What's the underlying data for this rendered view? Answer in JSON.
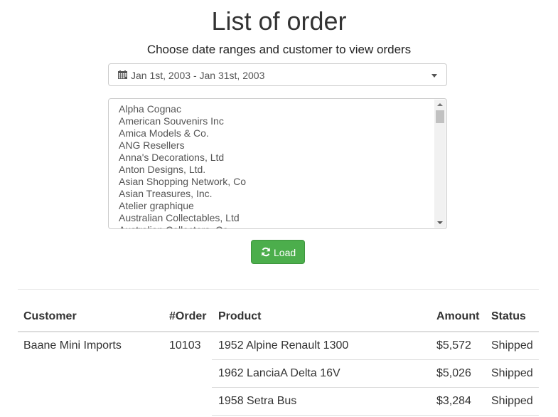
{
  "page_title": "List of order",
  "subtitle": "Choose date ranges and customer to view orders",
  "date_range": "Jan 1st, 2003 - Jan 31st, 2003",
  "customers": [
    "Alpha Cognac",
    "American Souvenirs Inc",
    "Amica Models & Co.",
    "ANG Resellers",
    "Anna's Decorations, Ltd",
    "Anton Designs, Ltd.",
    "Asian Shopping Network, Co",
    "Asian Treasures, Inc.",
    "Atelier graphique",
    "Australian Collectables, Ltd",
    "Australian Collectors, Co."
  ],
  "load_button": "Load",
  "table": {
    "headers": {
      "customer": "Customer",
      "order": "#Order",
      "product": "Product",
      "amount": "Amount",
      "status": "Status"
    },
    "customer": "Baane Mini Imports",
    "order": "10103",
    "rows": [
      {
        "product": "1952 Alpine Renault 1300",
        "amount": "$5,572",
        "status": "Shipped"
      },
      {
        "product": "1962 LanciaA Delta 16V",
        "amount": "$5,026",
        "status": "Shipped"
      },
      {
        "product": "1958 Setra Bus",
        "amount": "$3,284",
        "status": "Shipped"
      }
    ]
  },
  "colors": {
    "accent_green": "#4cae4c",
    "border": "#cccccc"
  },
  "icons": {
    "date_picker": "calendar-icon",
    "load": "refresh-icon"
  }
}
